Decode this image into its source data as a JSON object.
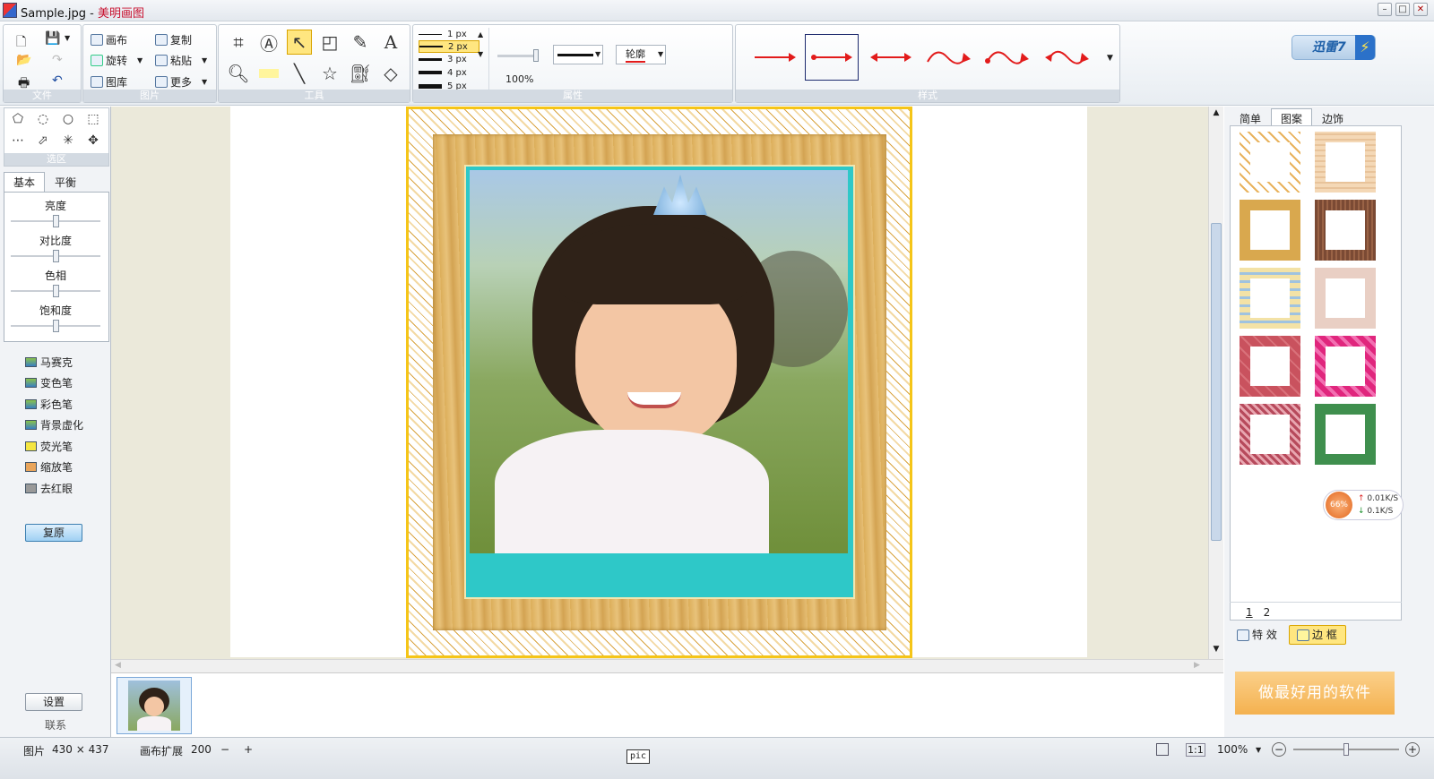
{
  "titlebar": {
    "filename": "Sample.jpg",
    "separator": " - ",
    "app_name": "美明画图"
  },
  "window_controls": {
    "minimize": "–",
    "maximize": "□",
    "close": "✕"
  },
  "xunlei": {
    "label": "迅雷7",
    "bolt": "⚡"
  },
  "ribbon": {
    "groups": {
      "file": "文件",
      "picture": "图片",
      "tools": "工具",
      "properties": "属性",
      "style": "样式"
    },
    "picture": {
      "canvas": "画布",
      "copy": "复制",
      "rotate": "旋转",
      "paste": "粘贴",
      "gallery": "图库",
      "more": "更多"
    },
    "line_widths": [
      "1 px",
      "2 px",
      "3 px",
      "4 px",
      "5 px"
    ],
    "selected_line_width": "2 px",
    "zoom": "100%",
    "outline_label": "轮廓",
    "arrow_color": "#e21b1b"
  },
  "left_panel": {
    "selection_label": "选区",
    "tabs": {
      "basic": "基本",
      "balance": "平衡"
    },
    "sliders": {
      "brightness": "亮度",
      "contrast": "对比度",
      "hue": "色相",
      "saturation": "饱和度"
    },
    "sliders_values": {
      "brightness": 0.5,
      "contrast": 0.5,
      "hue": 0.5,
      "saturation": 0.5
    },
    "effects": [
      "马赛克",
      "变色笔",
      "彩色笔",
      "背景虚化",
      "荧光笔",
      "缩放笔",
      "去红眼"
    ],
    "restore": "复原",
    "settings": "设置",
    "contact": "联系"
  },
  "right_panel": {
    "tabs": {
      "simple": "简单",
      "pattern": "图案",
      "border": "边饰"
    },
    "pages": [
      "1",
      "2"
    ],
    "bottom_tabs": {
      "effects": "特 效",
      "frames": "边 框"
    },
    "promo": "做最好用的软件",
    "network": {
      "percent": "66%",
      "up": "0.01K/S",
      "down": "0.1K/S"
    }
  },
  "statusbar": {
    "picture_label": "图片",
    "picture_size": "430 × 437",
    "canvas_expand_label": "画布扩展",
    "canvas_expand_value": "200",
    "minus": "−",
    "plus": "+",
    "pic_label": "pic",
    "one_to_one": "1:1",
    "zoom": "100%"
  }
}
